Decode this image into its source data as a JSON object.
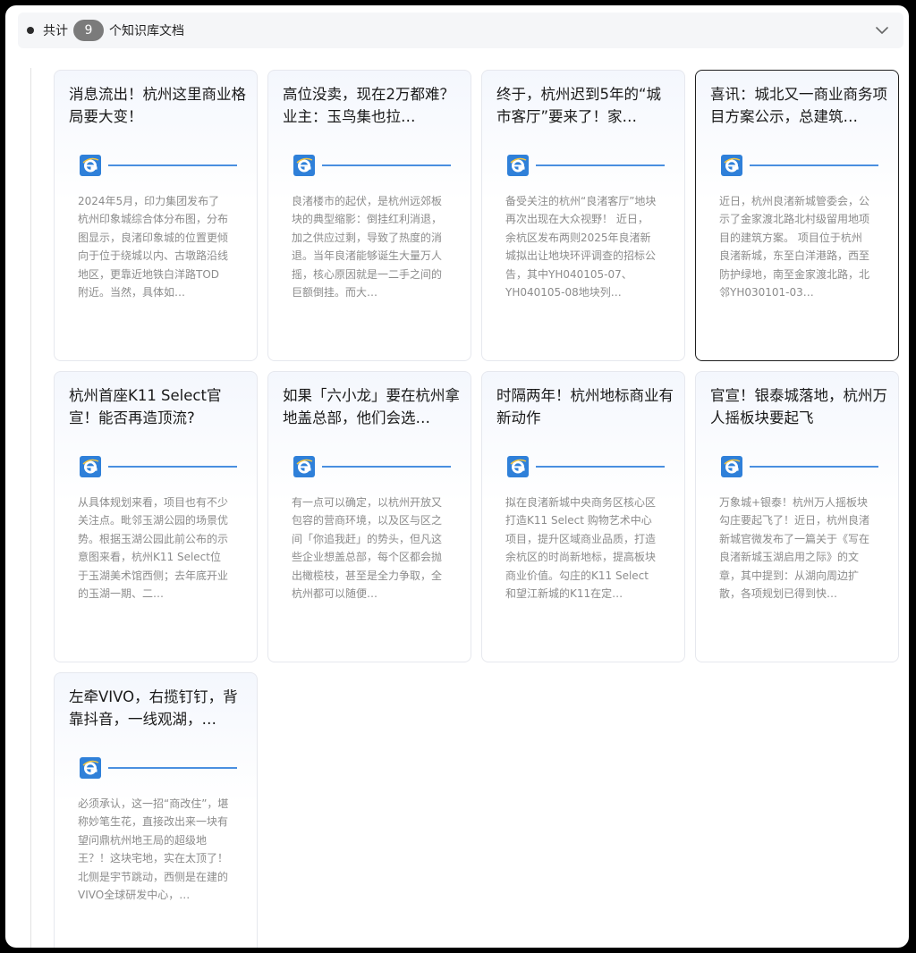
{
  "header": {
    "prefix": "共计",
    "count": "9",
    "suffix": "个知识库文档",
    "collapse_icon": "chevron-down-icon"
  },
  "source_icon": "browser-e-icon",
  "colors": {
    "accent": "#4a8fe0",
    "badge": "#7b7b7b",
    "selected_border": "#1f1f1f"
  },
  "cards": [
    {
      "title": "消息流出！杭州这里商业格局要大变！",
      "body": "2024年5月，印力集团发布了杭州印象城综合体分布图，分布图显示，良渚印象城的位置更倾向于位于绕城以内、古墩路沿线地区，更靠近地铁白洋路TOD附近。当然，具体如…"
    },
    {
      "title": "高位没卖，现在2万都难？业主：玉鸟集也拉…",
      "body": "良渚楼市的起伏，是杭州远郊板块的典型缩影：倒挂红利消退，加之供应过剩，导致了热度的消退。当年良渚能够诞生大量万人摇，核心原因就是一二手之间的巨额倒挂。而大…"
    },
    {
      "title": "终于，杭州迟到5年的“城市客厅”要来了！家…",
      "body": "备受关注的杭州“良渚客厅”地块再次出现在大众视野！ 近日，余杭区发布两则2025年良渚新城拟出让地块环评调查的招标公告，其中YH040105-07、YH040105-08地块列…"
    },
    {
      "title": "喜讯：城北又一商业商务项目方案公示，总建筑…",
      "body": "近日，杭州良渚新城管委会，公示了金家渡北路北村级留用地项目的建筑方案。 项目位于杭州良渚新城，东至白洋港路，西至防护绿地，南至金家渡北路，北邻YH030101-03…"
    },
    {
      "title": "杭州首座K11 Select官宣！能否再造顶流?",
      "body": "从具体规划来看，项目也有不少关注点。毗邻玉湖公园的场景优势。根据玉湖公园此前公布的示意图来看，杭州K11 Select位于玉湖美术馆西侧；去年底开业的玉湖一期、二…"
    },
    {
      "title": "如果「六小龙」要在杭州拿地盖总部，他们会选…",
      "body": "有一点可以确定，以杭州开放又包容的营商环境，以及区与区之间「你追我赶」的势头，但凡这些企业想盖总部，每个区都会抛出橄榄枝，甚至是全力争取，全杭州都可以随便…"
    },
    {
      "title": "时隔两年！杭州地标商业有新动作",
      "body": "拟在良渚新城中央商务区核心区打造K11 Select 购物艺术中心项目，提升区域商业品质，打造余杭区的时尚新地标，提高板块商业价值。勾庄的K11 Select和望江新城的K11在定…"
    },
    {
      "title": "官宣！银泰城落地，杭州万人摇板块要起飞",
      "body": "万象城+银泰！杭州万人摇板块勾庄要起飞了！近日，杭州良渚新城官微发布了一篇关于《写在良渚新城玉湖启用之际》的文章，其中提到：从湖向周边扩散，各项规划已得到快…"
    },
    {
      "title": "左牵VIVO，右揽钉钉，背靠抖音，一线观湖，…",
      "body": "必须承认，这一招“商改住”，堪称妙笔生花，直接改出来一块有望问鼎杭州地王局的超级地王？！这块宅地，实在太顶了！北侧是宇节跳动，西侧是在建的VIVO全球研发中心，…"
    }
  ]
}
